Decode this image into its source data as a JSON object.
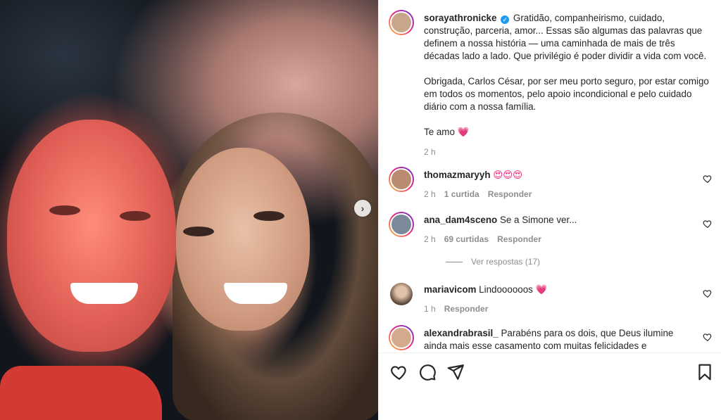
{
  "post": {
    "author": "sorayathronicke",
    "caption_p1": "Gratidão, companheirismo, cuidado, construção, parceria, amor... Essas são algumas das palavras que definem a nossa história — uma caminhada de mais de três décadas lado a lado. Que privilégio é poder dividir a vida com você.",
    "caption_p2": "Obrigada, Carlos César, por ser meu porto seguro, por estar comigo em todos os momentos, pelo apoio incondicional e pelo cuidado diário com a nossa família.",
    "caption_p3": "Te amo",
    "caption_p3_emoji": "💗",
    "time": "2 h"
  },
  "comments": [
    {
      "user": "thomazmaryyh",
      "text": "😍😍😍",
      "time": "2 h",
      "likes": "1 curtida",
      "reply": "Responder"
    },
    {
      "user": "ana_dam4sceno",
      "text": "Se a Simone ver...",
      "time": "2 h",
      "likes": "69 curtidas",
      "reply": "Responder"
    },
    {
      "user": "mariavicom",
      "text": "Lindoooooos",
      "emoji": "💗",
      "time": "1 h",
      "reply": "Responder"
    },
    {
      "user": "alexandrabrasil_",
      "text": "Parabéns para os dois, que Deus ilumine ainda mais esse casamento com muitas felicidades e"
    }
  ],
  "view_replies": "Ver respostas (17)",
  "icons": {
    "like": "heart-icon",
    "comment": "comment-icon",
    "share": "share-icon",
    "save": "bookmark-icon",
    "next": "chevron-right-icon",
    "verified": "verified-badge-icon"
  },
  "colors": {
    "verified": "#1d9bf0",
    "story_ring": "#ee2a7b",
    "muted": "#8e8e8e"
  }
}
